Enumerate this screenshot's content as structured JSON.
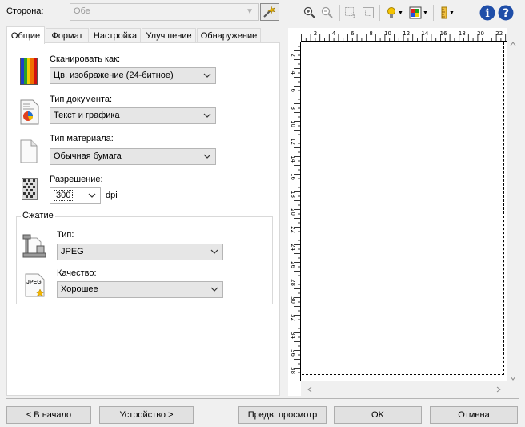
{
  "side": {
    "label": "Сторона:",
    "value": "Обе"
  },
  "tabs": [
    "Общие",
    "Формат",
    "Настройка",
    "Улучшение",
    "Обнаружение"
  ],
  "general": {
    "scan_as": {
      "label": "Сканировать как:",
      "value": "Цв. изображение (24-битное)"
    },
    "doc_type": {
      "label": "Тип документа:",
      "value": "Текст и графика"
    },
    "media_type": {
      "label": "Тип материала:",
      "value": "Обычная бумага"
    },
    "resolution": {
      "label": "Разрешение:",
      "value": "300",
      "unit": "dpi"
    },
    "compression": {
      "title": "Сжатие",
      "type": {
        "label": "Тип:",
        "value": "JPEG"
      },
      "quality": {
        "label": "Качество:",
        "value": "Хорошее"
      },
      "jpeg_icon_text": "JPEG"
    }
  },
  "ruler": {
    "top_labels": [
      "2",
      "4",
      "6",
      "8",
      "10",
      "12",
      "14",
      "16",
      "18",
      "20",
      "22"
    ],
    "left_labels": [
      "2",
      "4",
      "6",
      "8",
      "10",
      "12",
      "14",
      "16",
      "18",
      "20",
      "22",
      "24",
      "26",
      "28",
      "30",
      "32",
      "34",
      "36",
      "38"
    ]
  },
  "buttons": {
    "home": "< В начало",
    "device": "Устройство >",
    "preview": "Предв. просмотр",
    "ok": "OK",
    "cancel": "Отмена"
  },
  "icons": [
    "zoom-in-icon",
    "zoom-out-icon",
    "select-area-icon",
    "fit-icon",
    "light-icon",
    "color-icon",
    "ruler-icon",
    "info-icon",
    "help-icon"
  ]
}
